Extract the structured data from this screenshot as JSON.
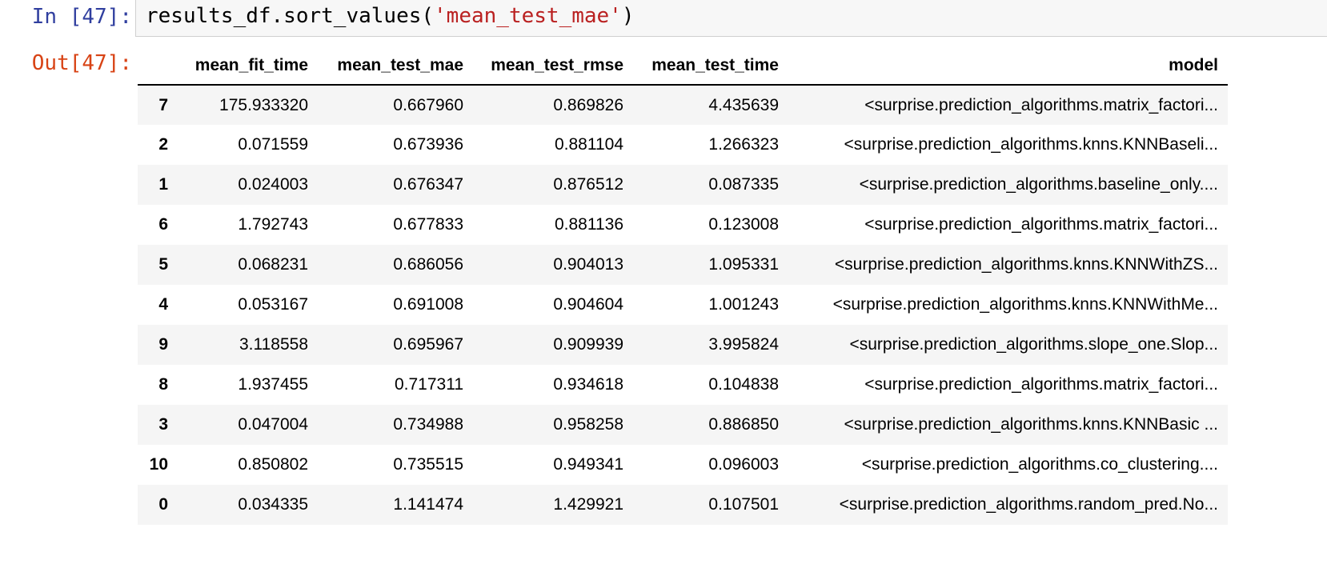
{
  "input_cell": {
    "prompt": "In [47]:",
    "code_prefix": "results_df.sort_values(",
    "code_string": "'mean_test_mae'",
    "code_suffix": ")"
  },
  "output_cell": {
    "prompt": "Out[47]:"
  },
  "table": {
    "columns": [
      "mean_fit_time",
      "mean_test_mae",
      "mean_test_rmse",
      "mean_test_time",
      "model"
    ],
    "rows": [
      {
        "index": "7",
        "mean_fit_time": "175.933320",
        "mean_test_mae": "0.667960",
        "mean_test_rmse": "0.869826",
        "mean_test_time": "4.435639",
        "model": "<surprise.prediction_algorithms.matrix_factori..."
      },
      {
        "index": "2",
        "mean_fit_time": "0.071559",
        "mean_test_mae": "0.673936",
        "mean_test_rmse": "0.881104",
        "mean_test_time": "1.266323",
        "model": "<surprise.prediction_algorithms.knns.KNNBaseli..."
      },
      {
        "index": "1",
        "mean_fit_time": "0.024003",
        "mean_test_mae": "0.676347",
        "mean_test_rmse": "0.876512",
        "mean_test_time": "0.087335",
        "model": "<surprise.prediction_algorithms.baseline_only...."
      },
      {
        "index": "6",
        "mean_fit_time": "1.792743",
        "mean_test_mae": "0.677833",
        "mean_test_rmse": "0.881136",
        "mean_test_time": "0.123008",
        "model": "<surprise.prediction_algorithms.matrix_factori..."
      },
      {
        "index": "5",
        "mean_fit_time": "0.068231",
        "mean_test_mae": "0.686056",
        "mean_test_rmse": "0.904013",
        "mean_test_time": "1.095331",
        "model": "<surprise.prediction_algorithms.knns.KNNWithZS..."
      },
      {
        "index": "4",
        "mean_fit_time": "0.053167",
        "mean_test_mae": "0.691008",
        "mean_test_rmse": "0.904604",
        "mean_test_time": "1.001243",
        "model": "<surprise.prediction_algorithms.knns.KNNWithMe..."
      },
      {
        "index": "9",
        "mean_fit_time": "3.118558",
        "mean_test_mae": "0.695967",
        "mean_test_rmse": "0.909939",
        "mean_test_time": "3.995824",
        "model": "<surprise.prediction_algorithms.slope_one.Slop..."
      },
      {
        "index": "8",
        "mean_fit_time": "1.937455",
        "mean_test_mae": "0.717311",
        "mean_test_rmse": "0.934618",
        "mean_test_time": "0.104838",
        "model": "<surprise.prediction_algorithms.matrix_factori..."
      },
      {
        "index": "3",
        "mean_fit_time": "0.047004",
        "mean_test_mae": "0.734988",
        "mean_test_rmse": "0.958258",
        "mean_test_time": "0.886850",
        "model": "<surprise.prediction_algorithms.knns.KNNBasic ..."
      },
      {
        "index": "10",
        "mean_fit_time": "0.850802",
        "mean_test_mae": "0.735515",
        "mean_test_rmse": "0.949341",
        "mean_test_time": "0.096003",
        "model": "<surprise.prediction_algorithms.co_clustering...."
      },
      {
        "index": "0",
        "mean_fit_time": "0.034335",
        "mean_test_mae": "1.141474",
        "mean_test_rmse": "1.429921",
        "mean_test_time": "0.107501",
        "model": "<surprise.prediction_algorithms.random_pred.No..."
      }
    ]
  },
  "colors": {
    "in_prompt": "#303f9f",
    "out_prompt": "#d84315",
    "string_literal": "#ba2121",
    "input_bg": "#f7f7f7",
    "row_stripe": "#f5f5f5"
  }
}
